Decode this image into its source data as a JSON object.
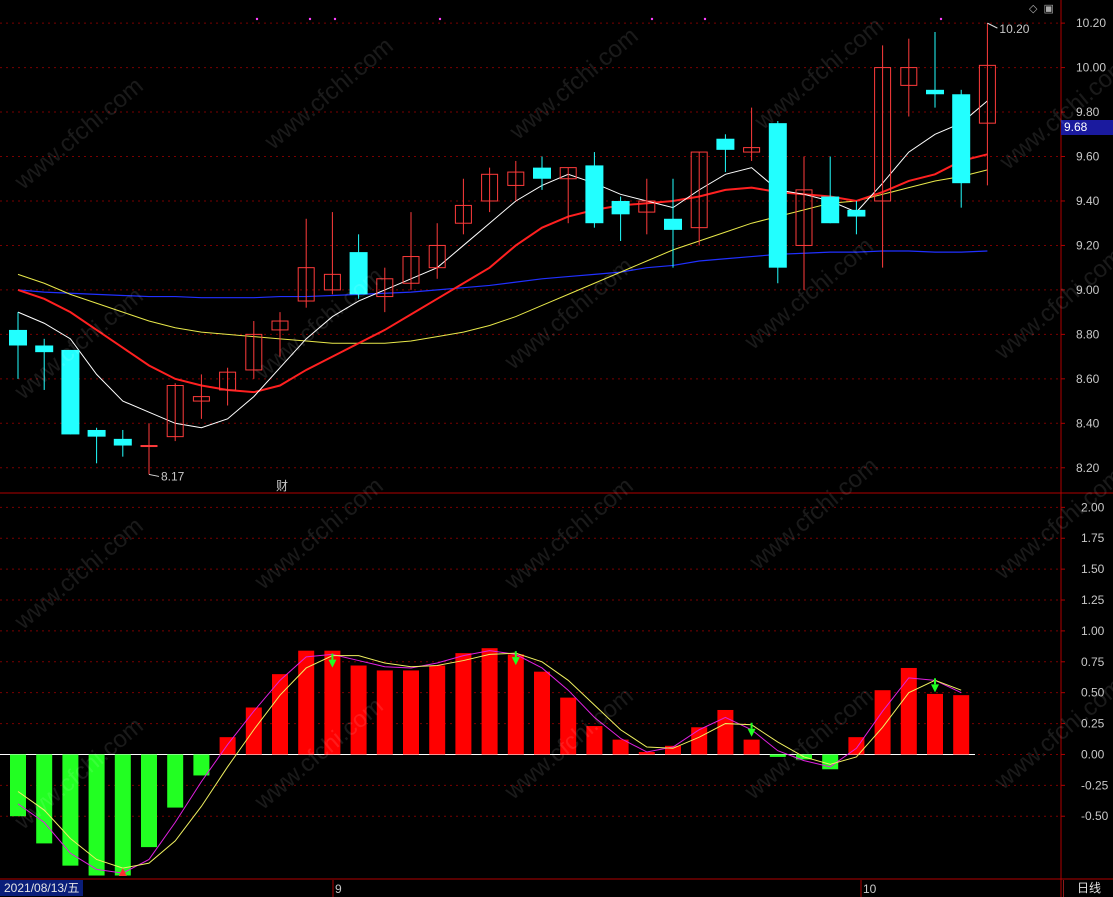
{
  "colors": {
    "up": "#ff3b3b",
    "down": "#22ffff",
    "ma5": "#ffffff",
    "ma10": "#ff2020",
    "ma20": "#e8e84a",
    "ma60": "#2030ff",
    "hist_pos": "#ff0000",
    "hist_neg": "#22ff22",
    "grid": "#7a0000",
    "axis": "#b00000"
  },
  "header": {
    "icons": [
      "diamond-icon",
      "window-toggle-icon"
    ]
  },
  "price_panel": {
    "current_price_tag": "9.68",
    "high_marker": "10.20",
    "low_marker": "8.17",
    "event_marker": "财",
    "y_ticks": [
      "10.20",
      "10.00",
      "9.80",
      "9.60",
      "9.40",
      "9.20",
      "9.00",
      "8.80",
      "8.60",
      "8.40",
      "8.20"
    ]
  },
  "indicator_panel": {
    "y_ticks": [
      "2.00",
      "1.75",
      "1.50",
      "1.25",
      "1.00",
      "0.75",
      "0.50",
      "0.25",
      "0.00",
      "-0.25",
      "-0.50"
    ]
  },
  "footer": {
    "date_label": "2021/08/13/五",
    "month_labels": [
      "9",
      "10"
    ],
    "period_tab": "日线"
  },
  "watermark_text": "www.cfchi.com",
  "chart_data": [
    {
      "type": "candlestick",
      "ylim": [
        8.1,
        10.25
      ],
      "candles": [
        {
          "o": 8.82,
          "h": 8.9,
          "l": 8.6,
          "c": 8.75
        },
        {
          "o": 8.75,
          "h": 8.78,
          "l": 8.55,
          "c": 8.72
        },
        {
          "o": 8.73,
          "h": 8.73,
          "l": 8.35,
          "c": 8.35
        },
        {
          "o": 8.37,
          "h": 8.38,
          "l": 8.22,
          "c": 8.34
        },
        {
          "o": 8.33,
          "h": 8.37,
          "l": 8.25,
          "c": 8.3
        },
        {
          "o": 8.3,
          "h": 8.4,
          "l": 8.17,
          "c": 8.3
        },
        {
          "o": 8.34,
          "h": 8.58,
          "l": 8.32,
          "c": 8.57
        },
        {
          "o": 8.5,
          "h": 8.62,
          "l": 8.42,
          "c": 8.52
        },
        {
          "o": 8.55,
          "h": 8.65,
          "l": 8.48,
          "c": 8.63
        },
        {
          "o": 8.64,
          "h": 8.86,
          "l": 8.6,
          "c": 8.8
        },
        {
          "o": 8.82,
          "h": 8.9,
          "l": 8.7,
          "c": 8.86
        },
        {
          "o": 8.95,
          "h": 9.32,
          "l": 8.92,
          "c": 9.1
        },
        {
          "o": 9.0,
          "h": 9.35,
          "l": 8.98,
          "c": 9.07
        },
        {
          "o": 9.17,
          "h": 9.25,
          "l": 8.96,
          "c": 8.98
        },
        {
          "o": 8.97,
          "h": 9.1,
          "l": 8.9,
          "c": 9.05
        },
        {
          "o": 9.03,
          "h": 9.35,
          "l": 9.0,
          "c": 9.15
        },
        {
          "o": 9.1,
          "h": 9.3,
          "l": 9.05,
          "c": 9.2
        },
        {
          "o": 9.3,
          "h": 9.5,
          "l": 9.25,
          "c": 9.38
        },
        {
          "o": 9.4,
          "h": 9.55,
          "l": 9.35,
          "c": 9.52
        },
        {
          "o": 9.47,
          "h": 9.58,
          "l": 9.4,
          "c": 9.53
        },
        {
          "o": 9.55,
          "h": 9.6,
          "l": 9.45,
          "c": 9.5
        },
        {
          "o": 9.5,
          "h": 9.55,
          "l": 9.3,
          "c": 9.55
        },
        {
          "o": 9.56,
          "h": 9.62,
          "l": 9.28,
          "c": 9.3
        },
        {
          "o": 9.4,
          "h": 9.42,
          "l": 9.22,
          "c": 9.34
        },
        {
          "o": 9.35,
          "h": 9.5,
          "l": 9.25,
          "c": 9.4
        },
        {
          "o": 9.32,
          "h": 9.5,
          "l": 9.1,
          "c": 9.27
        },
        {
          "o": 9.28,
          "h": 9.62,
          "l": 9.2,
          "c": 9.62
        },
        {
          "o": 9.68,
          "h": 9.7,
          "l": 9.53,
          "c": 9.63
        },
        {
          "o": 9.62,
          "h": 9.82,
          "l": 9.58,
          "c": 9.64
        },
        {
          "o": 9.75,
          "h": 9.76,
          "l": 9.03,
          "c": 9.1
        },
        {
          "o": 9.2,
          "h": 9.6,
          "l": 9.0,
          "c": 9.45
        },
        {
          "o": 9.42,
          "h": 9.6,
          "l": 9.3,
          "c": 9.3
        },
        {
          "o": 9.36,
          "h": 9.4,
          "l": 9.25,
          "c": 9.33
        },
        {
          "o": 9.4,
          "h": 10.1,
          "l": 9.1,
          "c": 10.0
        },
        {
          "o": 9.92,
          "h": 10.13,
          "l": 9.78,
          "c": 10.0
        },
        {
          "o": 9.9,
          "h": 10.16,
          "l": 9.82,
          "c": 9.88
        },
        {
          "o": 9.88,
          "h": 9.9,
          "l": 9.37,
          "c": 9.48
        },
        {
          "o": 9.75,
          "h": 10.2,
          "l": 9.47,
          "c": 10.01
        }
      ],
      "ma5": [
        8.9,
        8.85,
        8.78,
        8.62,
        8.5,
        8.45,
        8.4,
        8.38,
        8.42,
        8.52,
        8.65,
        8.78,
        8.88,
        8.95,
        9.0,
        9.05,
        9.1,
        9.2,
        9.3,
        9.4,
        9.47,
        9.52,
        9.48,
        9.43,
        9.4,
        9.37,
        9.45,
        9.52,
        9.55,
        9.45,
        9.43,
        9.4,
        9.35,
        9.48,
        9.62,
        9.7,
        9.75,
        9.85
      ],
      "ma10": [
        9.0,
        8.96,
        8.9,
        8.82,
        8.74,
        8.66,
        8.6,
        8.57,
        8.55,
        8.54,
        8.57,
        8.64,
        8.7,
        8.76,
        8.82,
        8.89,
        8.96,
        9.03,
        9.1,
        9.2,
        9.28,
        9.33,
        9.36,
        9.38,
        9.39,
        9.4,
        9.42,
        9.45,
        9.46,
        9.44,
        9.43,
        9.42,
        9.4,
        9.44,
        9.49,
        9.52,
        9.58,
        9.61
      ],
      "ma20": [
        9.07,
        9.03,
        8.98,
        8.94,
        8.9,
        8.86,
        8.83,
        8.81,
        8.8,
        8.79,
        8.78,
        8.77,
        8.76,
        8.76,
        8.76,
        8.77,
        8.79,
        8.81,
        8.84,
        8.88,
        8.93,
        8.98,
        9.03,
        9.08,
        9.13,
        9.18,
        9.22,
        9.26,
        9.3,
        9.33,
        9.36,
        9.39,
        9.4,
        9.43,
        9.46,
        9.49,
        9.51,
        9.54
      ],
      "ma60": [
        9.0,
        8.99,
        8.985,
        8.98,
        8.975,
        8.97,
        8.97,
        8.965,
        8.965,
        8.965,
        8.97,
        8.97,
        8.975,
        8.98,
        8.985,
        8.99,
        9.0,
        9.01,
        9.02,
        9.035,
        9.05,
        9.06,
        9.07,
        9.08,
        9.1,
        9.11,
        9.13,
        9.14,
        9.15,
        9.16,
        9.165,
        9.17,
        9.17,
        9.175,
        9.175,
        9.17,
        9.17,
        9.175
      ]
    },
    {
      "type": "bar",
      "ylim": [
        -1.0,
        2.1
      ],
      "values": [
        -0.5,
        -0.72,
        -0.9,
        -0.98,
        -0.98,
        -0.75,
        -0.43,
        -0.17,
        0.14,
        0.38,
        0.65,
        0.84,
        0.84,
        0.72,
        0.68,
        0.68,
        0.72,
        0.82,
        0.86,
        0.81,
        0.67,
        0.46,
        0.23,
        0.12,
        0.02,
        0.07,
        0.22,
        0.36,
        0.12,
        -0.02,
        -0.04,
        -0.12,
        0.14,
        0.52,
        0.7,
        0.49,
        0.48
      ],
      "dif": [
        -0.4,
        -0.55,
        -0.8,
        -0.93,
        -0.96,
        -0.85,
        -0.55,
        -0.22,
        0.08,
        0.35,
        0.6,
        0.79,
        0.81,
        0.76,
        0.71,
        0.7,
        0.74,
        0.8,
        0.84,
        0.81,
        0.7,
        0.52,
        0.3,
        0.13,
        0.02,
        0.06,
        0.2,
        0.3,
        0.2,
        0.03,
        -0.05,
        -0.1,
        0.05,
        0.35,
        0.62,
        0.6,
        0.5
      ],
      "dea": [
        -0.3,
        -0.45,
        -0.68,
        -0.85,
        -0.92,
        -0.88,
        -0.7,
        -0.42,
        -0.1,
        0.2,
        0.48,
        0.7,
        0.8,
        0.8,
        0.74,
        0.71,
        0.72,
        0.76,
        0.81,
        0.82,
        0.75,
        0.6,
        0.4,
        0.2,
        0.06,
        0.05,
        0.14,
        0.25,
        0.24,
        0.1,
        -0.02,
        -0.08,
        -0.02,
        0.22,
        0.5,
        0.6,
        0.52
      ],
      "up_arrows": [
        4
      ],
      "down_arrows": [
        12,
        19,
        28,
        35
      ]
    }
  ]
}
